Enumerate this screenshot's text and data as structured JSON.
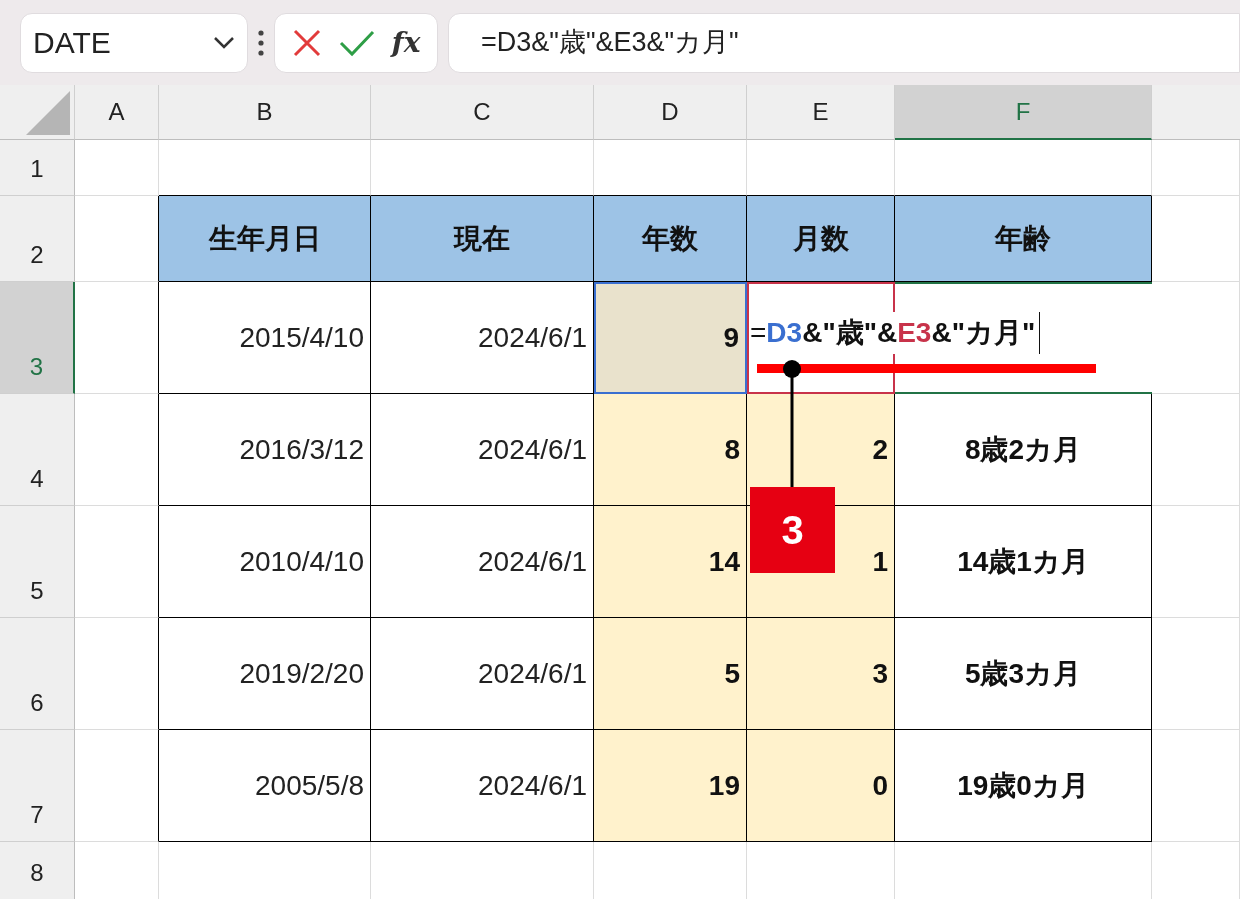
{
  "name_box": {
    "value": "DATE"
  },
  "formula_bar": {
    "fx": "fx",
    "formula": "=D3&\"歳\"&E3&\"カ月\""
  },
  "columns": [
    {
      "label": "A",
      "selected": false
    },
    {
      "label": "B",
      "selected": false
    },
    {
      "label": "C",
      "selected": false
    },
    {
      "label": "D",
      "selected": false
    },
    {
      "label": "E",
      "selected": false
    },
    {
      "label": "F",
      "selected": true
    }
  ],
  "rows": [
    {
      "label": "1",
      "selected": false
    },
    {
      "label": "2",
      "selected": false
    },
    {
      "label": "3",
      "selected": true
    },
    {
      "label": "4",
      "selected": false
    },
    {
      "label": "5",
      "selected": false
    },
    {
      "label": "6",
      "selected": false
    },
    {
      "label": "7",
      "selected": false
    },
    {
      "label": "8",
      "selected": false
    }
  ],
  "table": {
    "headers": [
      "生年月日",
      "現在",
      "年数",
      "月数",
      "年齢"
    ],
    "rows": [
      {
        "birth": "2015/4/10",
        "current": "2024/6/1",
        "years": "9",
        "editing": true
      },
      {
        "birth": "2016/3/12",
        "current": "2024/6/1",
        "years": "8",
        "months": "2",
        "age": "8歳2カ月",
        "editing": false
      },
      {
        "birth": "2010/4/10",
        "current": "2024/6/1",
        "years": "14",
        "months": "1",
        "age": "14歳1カ月",
        "editing": false
      },
      {
        "birth": "2019/2/20",
        "current": "2024/6/1",
        "years": "5",
        "months": "3",
        "age": "5歳3カ月",
        "editing": false
      },
      {
        "birth": "2005/5/8",
        "current": "2024/6/1",
        "years": "19",
        "months": "0",
        "age": "19歳0カ月",
        "editing": false
      }
    ]
  },
  "cell_editor": {
    "parts": [
      {
        "kind": "plain",
        "text": "="
      },
      {
        "kind": "ref",
        "text": "D3",
        "color": "#3a6fd0"
      },
      {
        "kind": "plain",
        "text": "&\"歳\"&"
      },
      {
        "kind": "ref",
        "text": "E3",
        "color": "#c8334a"
      },
      {
        "kind": "plain",
        "text": "&\"カ月\""
      }
    ]
  },
  "callout": {
    "label": "3"
  }
}
